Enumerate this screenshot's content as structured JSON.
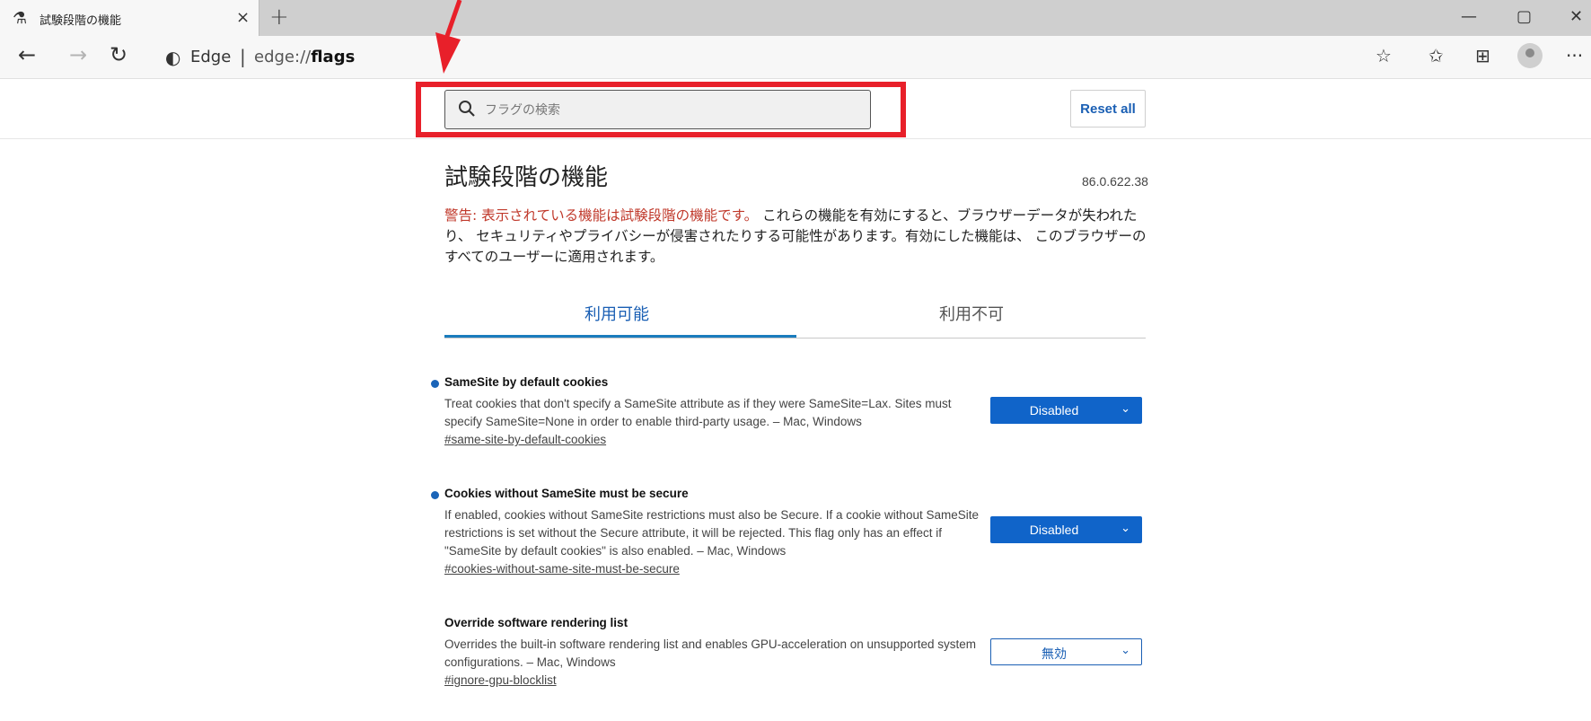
{
  "browser": {
    "tab_title": "試験段階の機能",
    "tab_icon": "flask-icon",
    "new_tab": "+",
    "close_tab": "×",
    "window_controls": {
      "minimize": "—",
      "maximize": "▢",
      "close": "✕"
    }
  },
  "nav": {
    "back": "←",
    "forward": "→",
    "refresh": "↻",
    "site_name": "Edge",
    "separator": "|",
    "url_prefix": "edge://",
    "url_path": "flags",
    "toolbar_icons": [
      "star-icon",
      "favorites-icon",
      "collections-icon",
      "profile-icon",
      "more-icon"
    ],
    "more": "···"
  },
  "search": {
    "placeholder": "フラグの検索",
    "value": ""
  },
  "reset_label": "Reset all",
  "page": {
    "title": "試験段階の機能",
    "version": "86.0.622.38",
    "warning_prefix": "警告: 表示されている機能は試験段階の機能です。",
    "warning_body": " これらの機能を有効にすると、ブラウザーデータが失われたり、 セキュリティやプライバシーが侵害されたりする可能性があります。有効にした機能は、 このブラウザーのすべてのユーザーに適用されます。"
  },
  "tabs": {
    "available": "利用可能",
    "unavailable": "利用不可"
  },
  "flags": [
    {
      "title": "SameSite by default cookies",
      "description": "Treat cookies that don't specify a SameSite attribute as if they were SameSite=Lax. Sites must specify SameSite=None in order to enable third-party usage. – Mac, Windows",
      "link": "#same-site-by-default-cookies",
      "value": "Disabled",
      "modified": true
    },
    {
      "title": "Cookies without SameSite must be secure",
      "description": "If enabled, cookies without SameSite restrictions must also be Secure. If a cookie without SameSite restrictions is set without the Secure attribute, it will be rejected. This flag only has an effect if \"SameSite by default cookies\" is also enabled. – Mac, Windows",
      "link": "#cookies-without-same-site-must-be-secure",
      "value": "Disabled",
      "modified": true
    },
    {
      "title": "Override software rendering list",
      "description": "Overrides the built-in software rendering list and enables GPU-acceleration on unsupported system configurations. – Mac, Windows",
      "link": "#ignore-gpu-blocklist",
      "value": "無効",
      "modified": false
    }
  ],
  "colors": {
    "accent": "#1064c9",
    "annotation": "#e8202a",
    "warning_red": "#c0392b"
  }
}
